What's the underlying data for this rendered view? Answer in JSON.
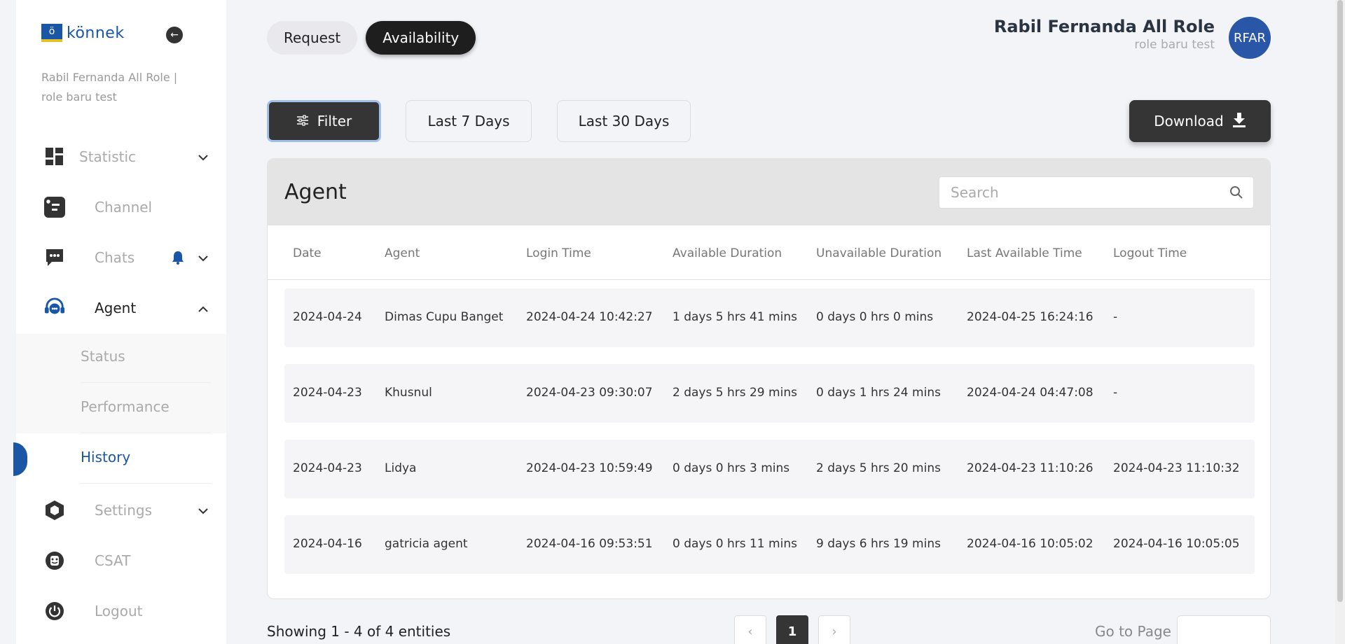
{
  "brand": {
    "mark": "ö",
    "name": "könnek"
  },
  "sidebar": {
    "user_sub": "Rabil Fernanda All Role | role baru test",
    "items": [
      {
        "label": "Statistic",
        "icon": "dashboard-icon"
      },
      {
        "label": "Channel",
        "icon": "channel-icon"
      },
      {
        "label": "Chats",
        "icon": "chat-icon"
      },
      {
        "label": "Agent",
        "icon": "headset-icon"
      },
      {
        "label": "Settings",
        "icon": "hexagon-settings-icon"
      },
      {
        "label": "CSAT",
        "icon": "smile-icon"
      },
      {
        "label": "Logout",
        "icon": "power-icon"
      }
    ],
    "agent_submenu": [
      "Status",
      "Performance",
      "History"
    ],
    "active_sub": "History"
  },
  "tabs": [
    "Request",
    "Availability"
  ],
  "active_tab": "Availability",
  "profile": {
    "name": "Rabil Fernanda All Role",
    "role": "role baru test",
    "initials": "RFAR"
  },
  "toolbar": {
    "filter": "Filter",
    "last7": "Last 7 Days",
    "last30": "Last 30 Days",
    "download": "Download"
  },
  "card": {
    "title": "Agent",
    "search_placeholder": "Search"
  },
  "table": {
    "columns": [
      "Date",
      "Agent",
      "Login Time",
      "Available Duration",
      "Unavailable Duration",
      "Last Available Time",
      "Logout Time"
    ],
    "rows": [
      [
        "2024-04-24",
        "Dimas Cupu Banget",
        "2024-04-24 10:42:27",
        "1 days 5 hrs 41 mins",
        "0 days 0 hrs 0 mins",
        "2024-04-25 16:24:16",
        "-"
      ],
      [
        "2024-04-23",
        "Khusnul",
        "2024-04-23 09:30:07",
        "2 days 5 hrs 29 mins",
        "0 days 1 hrs 24 mins",
        "2024-04-24 04:47:08",
        "-"
      ],
      [
        "2024-04-23",
        "Lidya",
        "2024-04-23 10:59:49",
        "0 days 0 hrs 3 mins",
        "2 days 5 hrs 20 mins",
        "2024-04-23 11:10:26",
        "2024-04-23 11:10:32"
      ],
      [
        "2024-04-16",
        "gatricia agent",
        "2024-04-16 09:53:51",
        "0 days 0 hrs 11 mins",
        "9 days 6 hrs 19 mins",
        "2024-04-16 10:05:02",
        "2024-04-16 10:05:05"
      ]
    ]
  },
  "pagination": {
    "showing": "Showing 1 - 4 of 4 entities",
    "current_page": "1",
    "prev": "‹",
    "next": "›",
    "goto_label": "Go to Page"
  },
  "colors": {
    "brand_blue": "#1a56a6",
    "dark_button": "#353535"
  }
}
